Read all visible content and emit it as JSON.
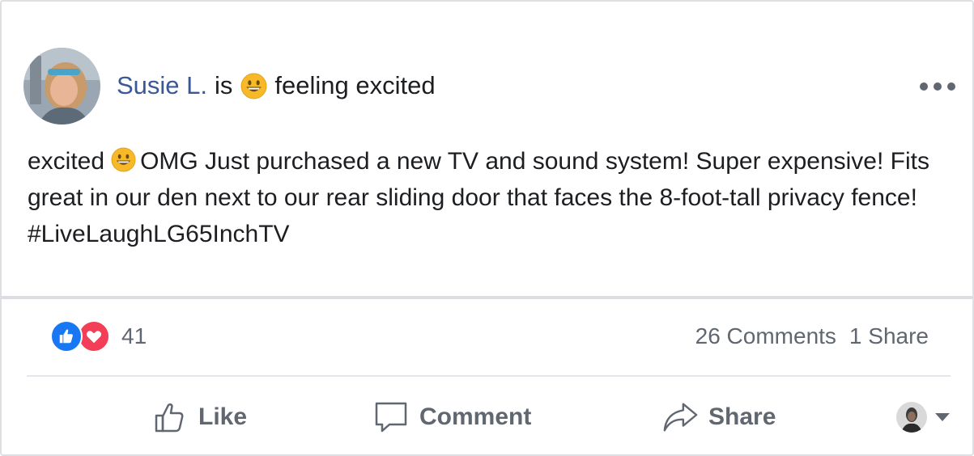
{
  "post": {
    "author": "Susie L.",
    "verb": "is",
    "feeling": "feeling excited",
    "text_lead": "excited",
    "text_body": "OMG Just purchased a new TV and sound system! Super expensive! Fits great in our den next to our rear sliding door that faces the 8-foot-tall privacy fence! #LiveLaughLG65InchTV"
  },
  "engagement": {
    "reaction_count": "41",
    "comments": "26 Comments",
    "shares": "1 Share"
  },
  "actions": {
    "like": "Like",
    "comment": "Comment",
    "share": "Share"
  },
  "icons": {
    "feeling": "grinning-face-emoji",
    "more": "more-options-icon",
    "like_reaction": "thumbs-up-reaction-icon",
    "love_reaction": "heart-reaction-icon",
    "like_action": "thumbs-up-outline-icon",
    "comment_action": "speech-bubble-icon",
    "share_action": "share-arrow-icon",
    "audience_caret": "caret-down-icon"
  },
  "colors": {
    "author": "#385898",
    "like_blue": "#1877f2",
    "love_red": "#f33e58",
    "muted": "#606770"
  }
}
